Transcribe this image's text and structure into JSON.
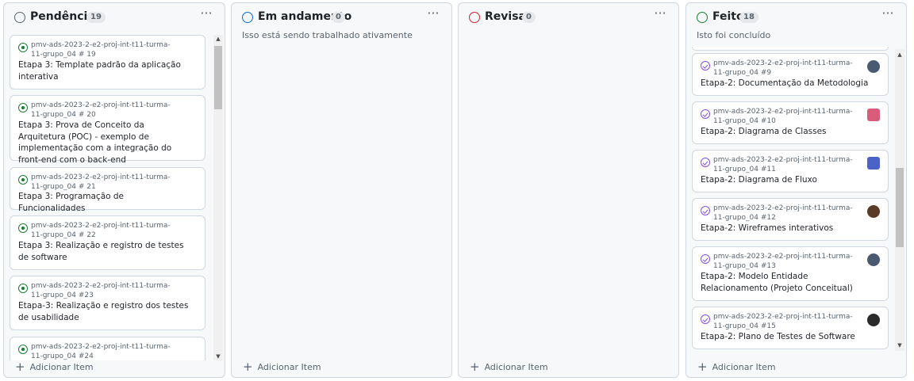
{
  "columns": [
    {
      "title": "Pendências",
      "count": "19",
      "description": "",
      "status_color": "#59636e",
      "add_label": "Adicionar Item",
      "cards": [
        {
          "repo": "pmv-ads-2023-2-e2-proj-int-t11-turma-11-grupo_04 # 19",
          "title": "Etapa 3: Template padrão da aplicação interativa"
        },
        {
          "repo": "pmv-ads-2023-2-e2-proj-int-t11-turma-11-grupo_04 # 20",
          "title": "Etapa 3: Prova de Conceito da Arquitetura (POC) - exemplo de implementação com a integração do front-end com o back-end"
        },
        {
          "repo": "pmv-ads-2023-2-e2-proj-int-t11-turma-11-grupo_04 # 21",
          "title": "Etapa 3: Programação de Funcionalidades"
        },
        {
          "repo": "pmv-ads-2023-2-e2-proj-int-t11-turma-11-grupo_04 # 22",
          "title": "Etapa 3: Realização e registro de testes de software"
        },
        {
          "repo": "pmv-ads-2023-2-e2-proj-int-t11-turma-11-grupo_04 #23",
          "title": "Etapa-3: Realização e registro dos testes de usabilidade"
        },
        {
          "repo": "pmv-ads-2023-2-e2-proj-int-t11-turma-11-grupo_04 #24",
          "title": ""
        }
      ]
    },
    {
      "title": "Em andamento",
      "count": "0",
      "description": "Isso está sendo trabalhado ativamente",
      "status_color": "#0969da",
      "add_label": "Adicionar Item",
      "cards": []
    },
    {
      "title": "Revisar",
      "count": "0",
      "description": "",
      "status_color": "#cf222e",
      "add_label": "Adicionar Item",
      "cards": []
    },
    {
      "title": "Feito",
      "count": "18",
      "description": "Isto foi concluído",
      "status_color": "#1a7f37",
      "add_label": "Adicionar Item",
      "cards": [
        {
          "repo": "pmv-ads-2023-2-e2-proj-int-t11-turma-11-grupo_04 #9",
          "title": "Etapa-2: Documentação da Metodologia",
          "avatar": "#4a5a70"
        },
        {
          "repo": "pmv-ads-2023-2-e2-proj-int-t11-turma-11-grupo_04 #10",
          "title": "Etapa-2: Diagrama de Classes",
          "avatar": "#d95c7a"
        },
        {
          "repo": "pmv-ads-2023-2-e2-proj-int-t11-turma-11-grupo_04 #11",
          "title": "Etapa-2: Diagrama de Fluxo",
          "avatar": "#4b63c9"
        },
        {
          "repo": "pmv-ads-2023-2-e2-proj-int-t11-turma-11-grupo_04 #12",
          "title": "Etapa-2: Wireframes interativos",
          "avatar": "#5a3a28"
        },
        {
          "repo": "pmv-ads-2023-2-e2-proj-int-t11-turma-11-grupo_04 #13",
          "title": "Etapa-2: Modelo Entidade Relacionamento (Projeto Conceitual)",
          "avatar": "#4a5a70"
        },
        {
          "repo": "pmv-ads-2023-2-e2-proj-int-t11-turma-11-grupo_04 #15",
          "title": "Etapa-2: Plano de Testes de Software",
          "avatar": "#2a2a2a"
        }
      ]
    }
  ],
  "icons": {
    "kebab": "kebab-menu-icon",
    "add": "plus-icon",
    "open_issue": "issue-open-icon",
    "closed_issue": "issue-closed-icon"
  }
}
